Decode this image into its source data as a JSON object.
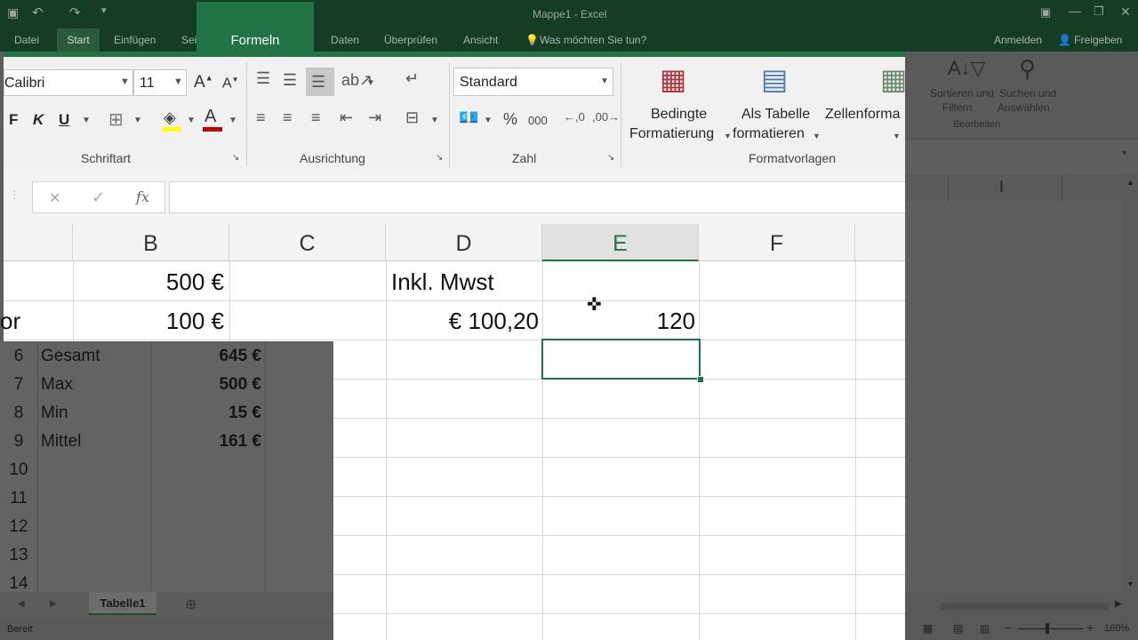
{
  "window": {
    "title": "Mappe1 - Excel",
    "account": "Anmelden",
    "share": "Freigeben"
  },
  "tabs": {
    "datei": "Datei",
    "start": "Start",
    "einfuegen": "Einfügen",
    "seite": "Sei",
    "formeln": "Formeln",
    "daten": "Daten",
    "ueberpruefen": "Überprüfen",
    "ansicht": "Ansicht",
    "tell_me": "Was möchten Sie tun?"
  },
  "ribbon": {
    "font_name": "Calibri",
    "font_size": "11",
    "bold": "F",
    "italic": "K",
    "underline": "U",
    "number_format": "Standard",
    "percent": "%",
    "thousands": "000",
    "cond_format_1": "Bedingte",
    "cond_format_2": "Formatierung",
    "as_table_1": "Als Tabelle",
    "as_table_2": "formatieren",
    "cell_styles": "Zellenforma",
    "sort_1": "Sortieren und",
    "sort_2": "Filtern",
    "find_1": "Suchen und",
    "find_2": "Auswählen",
    "groups": {
      "schriftart": "Schriftart",
      "ausrichtung": "Ausrichtung",
      "zahl": "Zahl",
      "formatvorlagen": "Formatvorlagen",
      "bearbeiten": "Bearbeiten"
    }
  },
  "formula_bar": {
    "cancel": "✕",
    "confirm": "✓",
    "fx": "fx",
    "value": ""
  },
  "columns": [
    "B",
    "C",
    "D",
    "E",
    "F"
  ],
  "zoomed_cells": {
    "b1": "500 €",
    "d1": "Inkl. Mwst",
    "a2_partial": "or",
    "b2": "100 €",
    "d2": "€ 100,20",
    "e2": "120"
  },
  "dim_rows": [
    {
      "num": "6",
      "label": "Gesamt",
      "value": "645 €"
    },
    {
      "num": "7",
      "label": "Max",
      "value": "500 €"
    },
    {
      "num": "8",
      "label": "Min",
      "value": "15 €"
    },
    {
      "num": "9",
      "label": "Mittel",
      "value": "161 €"
    },
    {
      "num": "10",
      "label": "",
      "value": ""
    },
    {
      "num": "11",
      "label": "",
      "value": ""
    },
    {
      "num": "12",
      "label": "",
      "value": ""
    },
    {
      "num": "13",
      "label": "",
      "value": ""
    },
    {
      "num": "14",
      "label": "",
      "value": ""
    }
  ],
  "sheet_tab": "Tabelle1",
  "status": {
    "ready": "Bereit",
    "zoom": "160%"
  },
  "colors": {
    "excel_green": "#217346",
    "title_dark": "#143d24",
    "selection": "#217346"
  }
}
